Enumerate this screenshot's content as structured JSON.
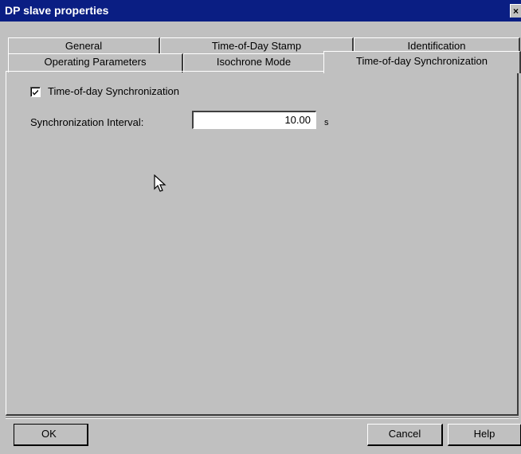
{
  "window": {
    "title": "DP slave properties",
    "close_glyph": "×"
  },
  "tabs": {
    "back_row": [
      "General",
      "Time-of-Day Stamp",
      "Identification"
    ],
    "front_row": [
      "Operating Parameters",
      "Isochrone Mode",
      "Time-of-day Synchronization"
    ],
    "active": "Time-of-day Synchronization"
  },
  "page": {
    "sync_checkbox": {
      "label": "Time-of-day Synchronization",
      "checked": true
    },
    "interval": {
      "label": "Synchronization Interval:",
      "value": "10.00",
      "unit": "s"
    }
  },
  "buttons": {
    "ok": "OK",
    "cancel": "Cancel",
    "help": "Help"
  },
  "icons": {
    "close": "close-icon",
    "check": "checkmark-icon",
    "cursor": "mouse-pointer-icon"
  }
}
